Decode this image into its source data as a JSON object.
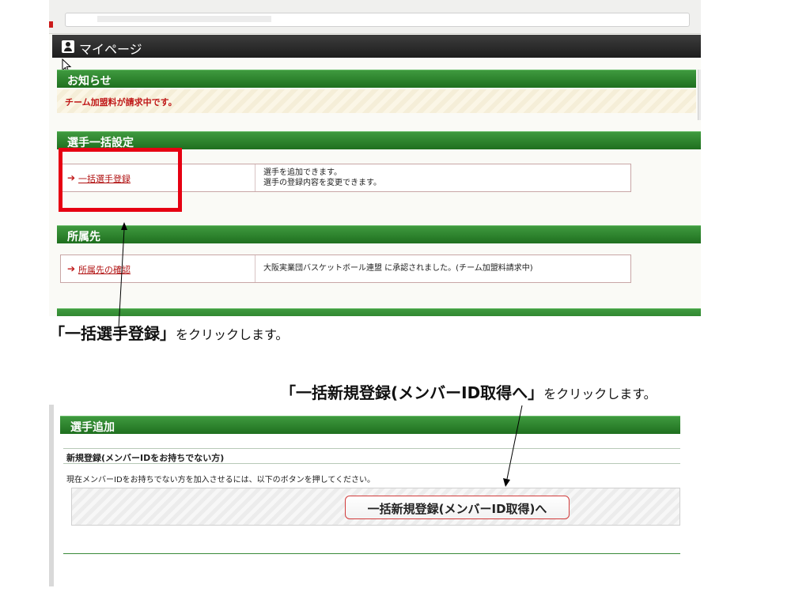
{
  "screen1": {
    "mypage_title": "マイページ",
    "notice_heading": "お知らせ",
    "notice_message": "チーム加盟料が請求中です。",
    "bulk_heading": "選手一括設定",
    "bulk_link": "一括選手登録",
    "bulk_desc_line1": "選手を追加できます。",
    "bulk_desc_line2": "選手の登録内容を変更できます。",
    "affiliation_heading": "所属先",
    "affiliation_link": "所属先の確認",
    "affiliation_desc": "大阪実業団バスケットボール連盟 に承認されました。(チーム加盟料請求中)"
  },
  "annotations": {
    "note1_emphasis": "「一括選手登録」",
    "note1_rest": "をクリックします。",
    "note2_emphasis": "「一括新規登録(メンバーID取得へ」",
    "note2_rest": "をクリックします。"
  },
  "screen2": {
    "add_heading": "選手追加",
    "new_registration_heading": "新規登録(メンバーIDをお持ちでない方)",
    "instructions": "現在メンバーIDをお持ちでない方を加入させるには、以下のボタンを押してください。",
    "register_button": "一括新規登録(メンバーID取得)へ"
  },
  "colors": {
    "header_green": "#2f852f",
    "highlight_red": "#e60012",
    "link_red": "#b01010"
  },
  "icons": [
    "user-icon",
    "arrow-right-icon",
    "mouse-cursor-icon"
  ]
}
